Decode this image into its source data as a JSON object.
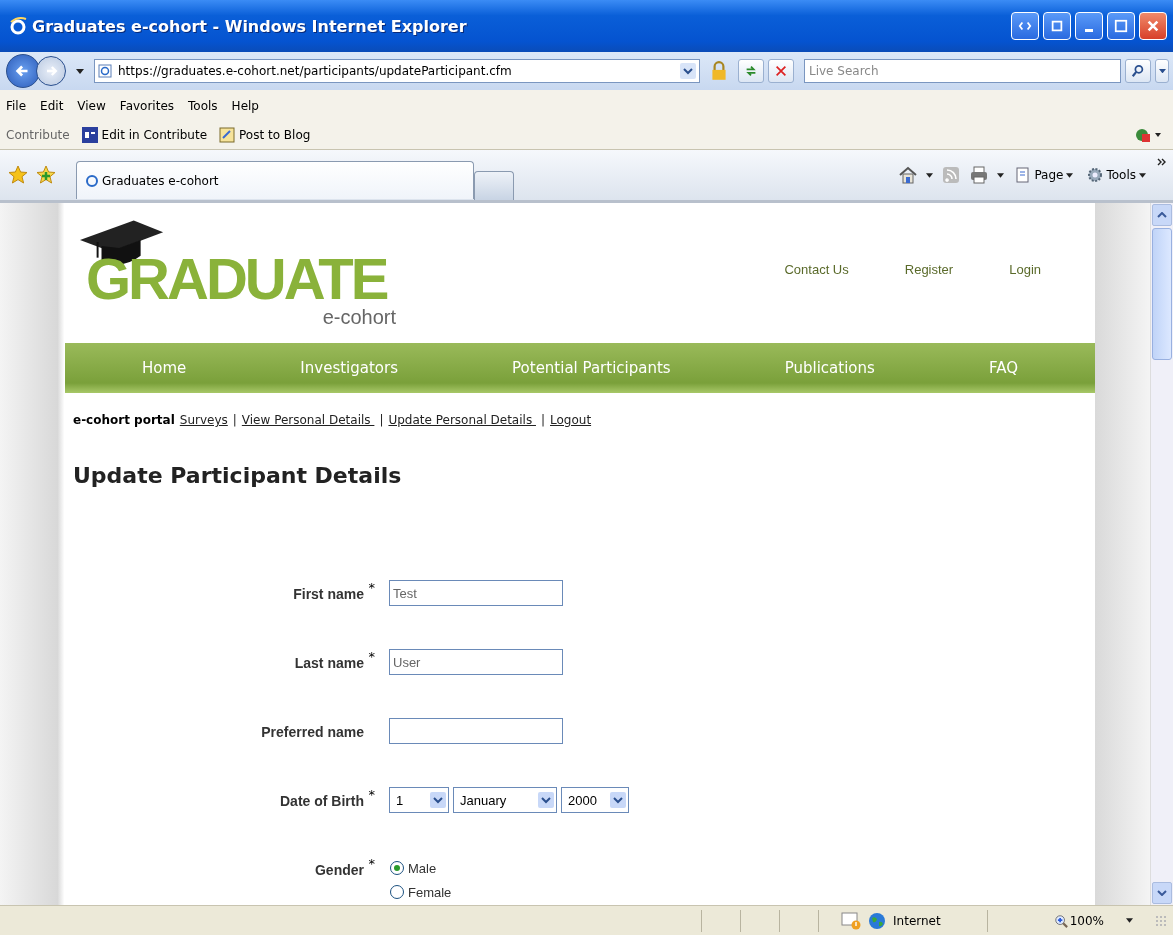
{
  "window": {
    "title": "Graduates e-cohort - Windows Internet Explorer"
  },
  "address": {
    "url": "https://graduates.e-cohort.net/participants/updateParticipant.cfm"
  },
  "search": {
    "placeholder": "Live Search"
  },
  "menu": [
    "File",
    "Edit",
    "View",
    "Favorites",
    "Tools",
    "Help"
  ],
  "links_toolbar": {
    "label": "Contribute",
    "buttons": [
      "Edit in Contribute",
      "Post to Blog"
    ]
  },
  "tabs": [
    {
      "label": "Graduates e-cohort",
      "selected": true
    }
  ],
  "command_bar": [
    "Page",
    "Tools"
  ],
  "page": {
    "logo": {
      "title": "GRADUATE",
      "subtitle": "e-cohort"
    },
    "top_links": [
      "Contact Us",
      "Register",
      "Login"
    ],
    "nav": [
      "Home",
      "Investigators",
      "Potential Participants",
      "Publications",
      "FAQ"
    ],
    "portal": {
      "label": "e-cohort portal",
      "links": [
        {
          "kind": "link",
          "text": "Surveys"
        },
        {
          "kind": "separator",
          "text": "|"
        },
        {
          "kind": "link",
          "text": "View Personal Details "
        },
        {
          "kind": "separator",
          "text": "|"
        },
        {
          "kind": "link",
          "text": "Update Personal Details "
        },
        {
          "kind": "separator",
          "text": "|"
        },
        {
          "kind": "link",
          "text": "Logout"
        }
      ]
    },
    "heading": "Update Participant Details",
    "fields": [
      {
        "kind": "text",
        "label": "First name",
        "required_mark": "*",
        "value": "Test"
      },
      {
        "kind": "text",
        "label": "Last name",
        "required_mark": "*",
        "value": "User"
      },
      {
        "kind": "text",
        "label": "Preferred name"
      },
      {
        "kind": "date",
        "label": "Date of Birth",
        "required_mark": "*",
        "selects": [
          "1",
          "January",
          "2000"
        ]
      },
      {
        "kind": "radio",
        "label": "Gender",
        "required_mark": "*",
        "options": [
          {
            "label": "Male",
            "selected": true
          },
          {
            "label": "Female",
            "selected": false
          }
        ]
      }
    ]
  },
  "status_bar": {
    "zone": "Internet",
    "zoom": "100%"
  }
}
